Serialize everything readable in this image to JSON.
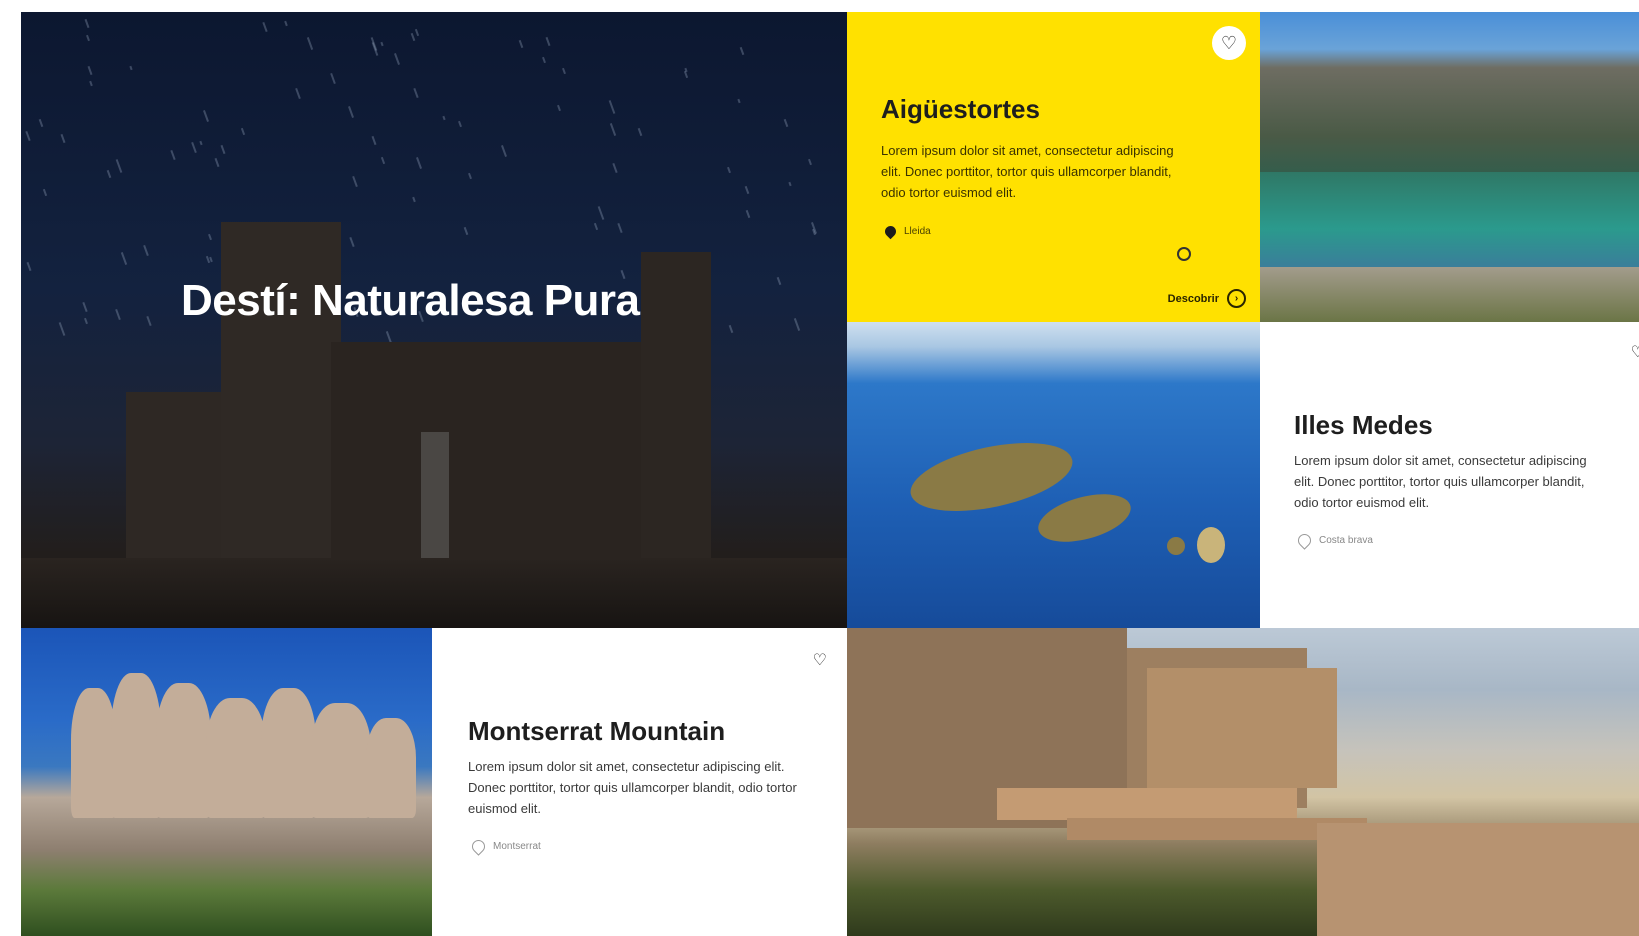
{
  "hero": {
    "title": "Destí: Naturalesa Pura"
  },
  "cards": {
    "aiguestortes": {
      "title": "Aigüestortes",
      "description": "Lorem ipsum dolor sit amet, consectetur adipiscing elit. Donec porttitor, tortor quis ullamcorper blandit, odio tortor euismod elit.",
      "location": "Lleida",
      "cta": "Descobrir",
      "background": "#ffe100"
    },
    "medes": {
      "title": "Illes Medes",
      "description": "Lorem ipsum dolor sit amet, consectetur adipiscing elit. Donec porttitor, tortor quis ullamcorper blandit, odio tortor euismod elit.",
      "location": "Costa brava",
      "background": "#ffffff"
    },
    "montserrat": {
      "title": "Montserrat Mountain",
      "description": "Lorem ipsum dolor sit amet, consectetur adipiscing elit. Donec porttitor, tortor quis ullamcorper blandit, odio tortor euismod elit.",
      "location": "Montserrat",
      "background": "#ffffff"
    }
  },
  "icons": {
    "favorite": "heart-outline-icon",
    "location": "location-pin-icon",
    "arrow": "arrow-right-circle-icon"
  },
  "glyphs": {
    "heart": "♡",
    "arrow": "›"
  }
}
